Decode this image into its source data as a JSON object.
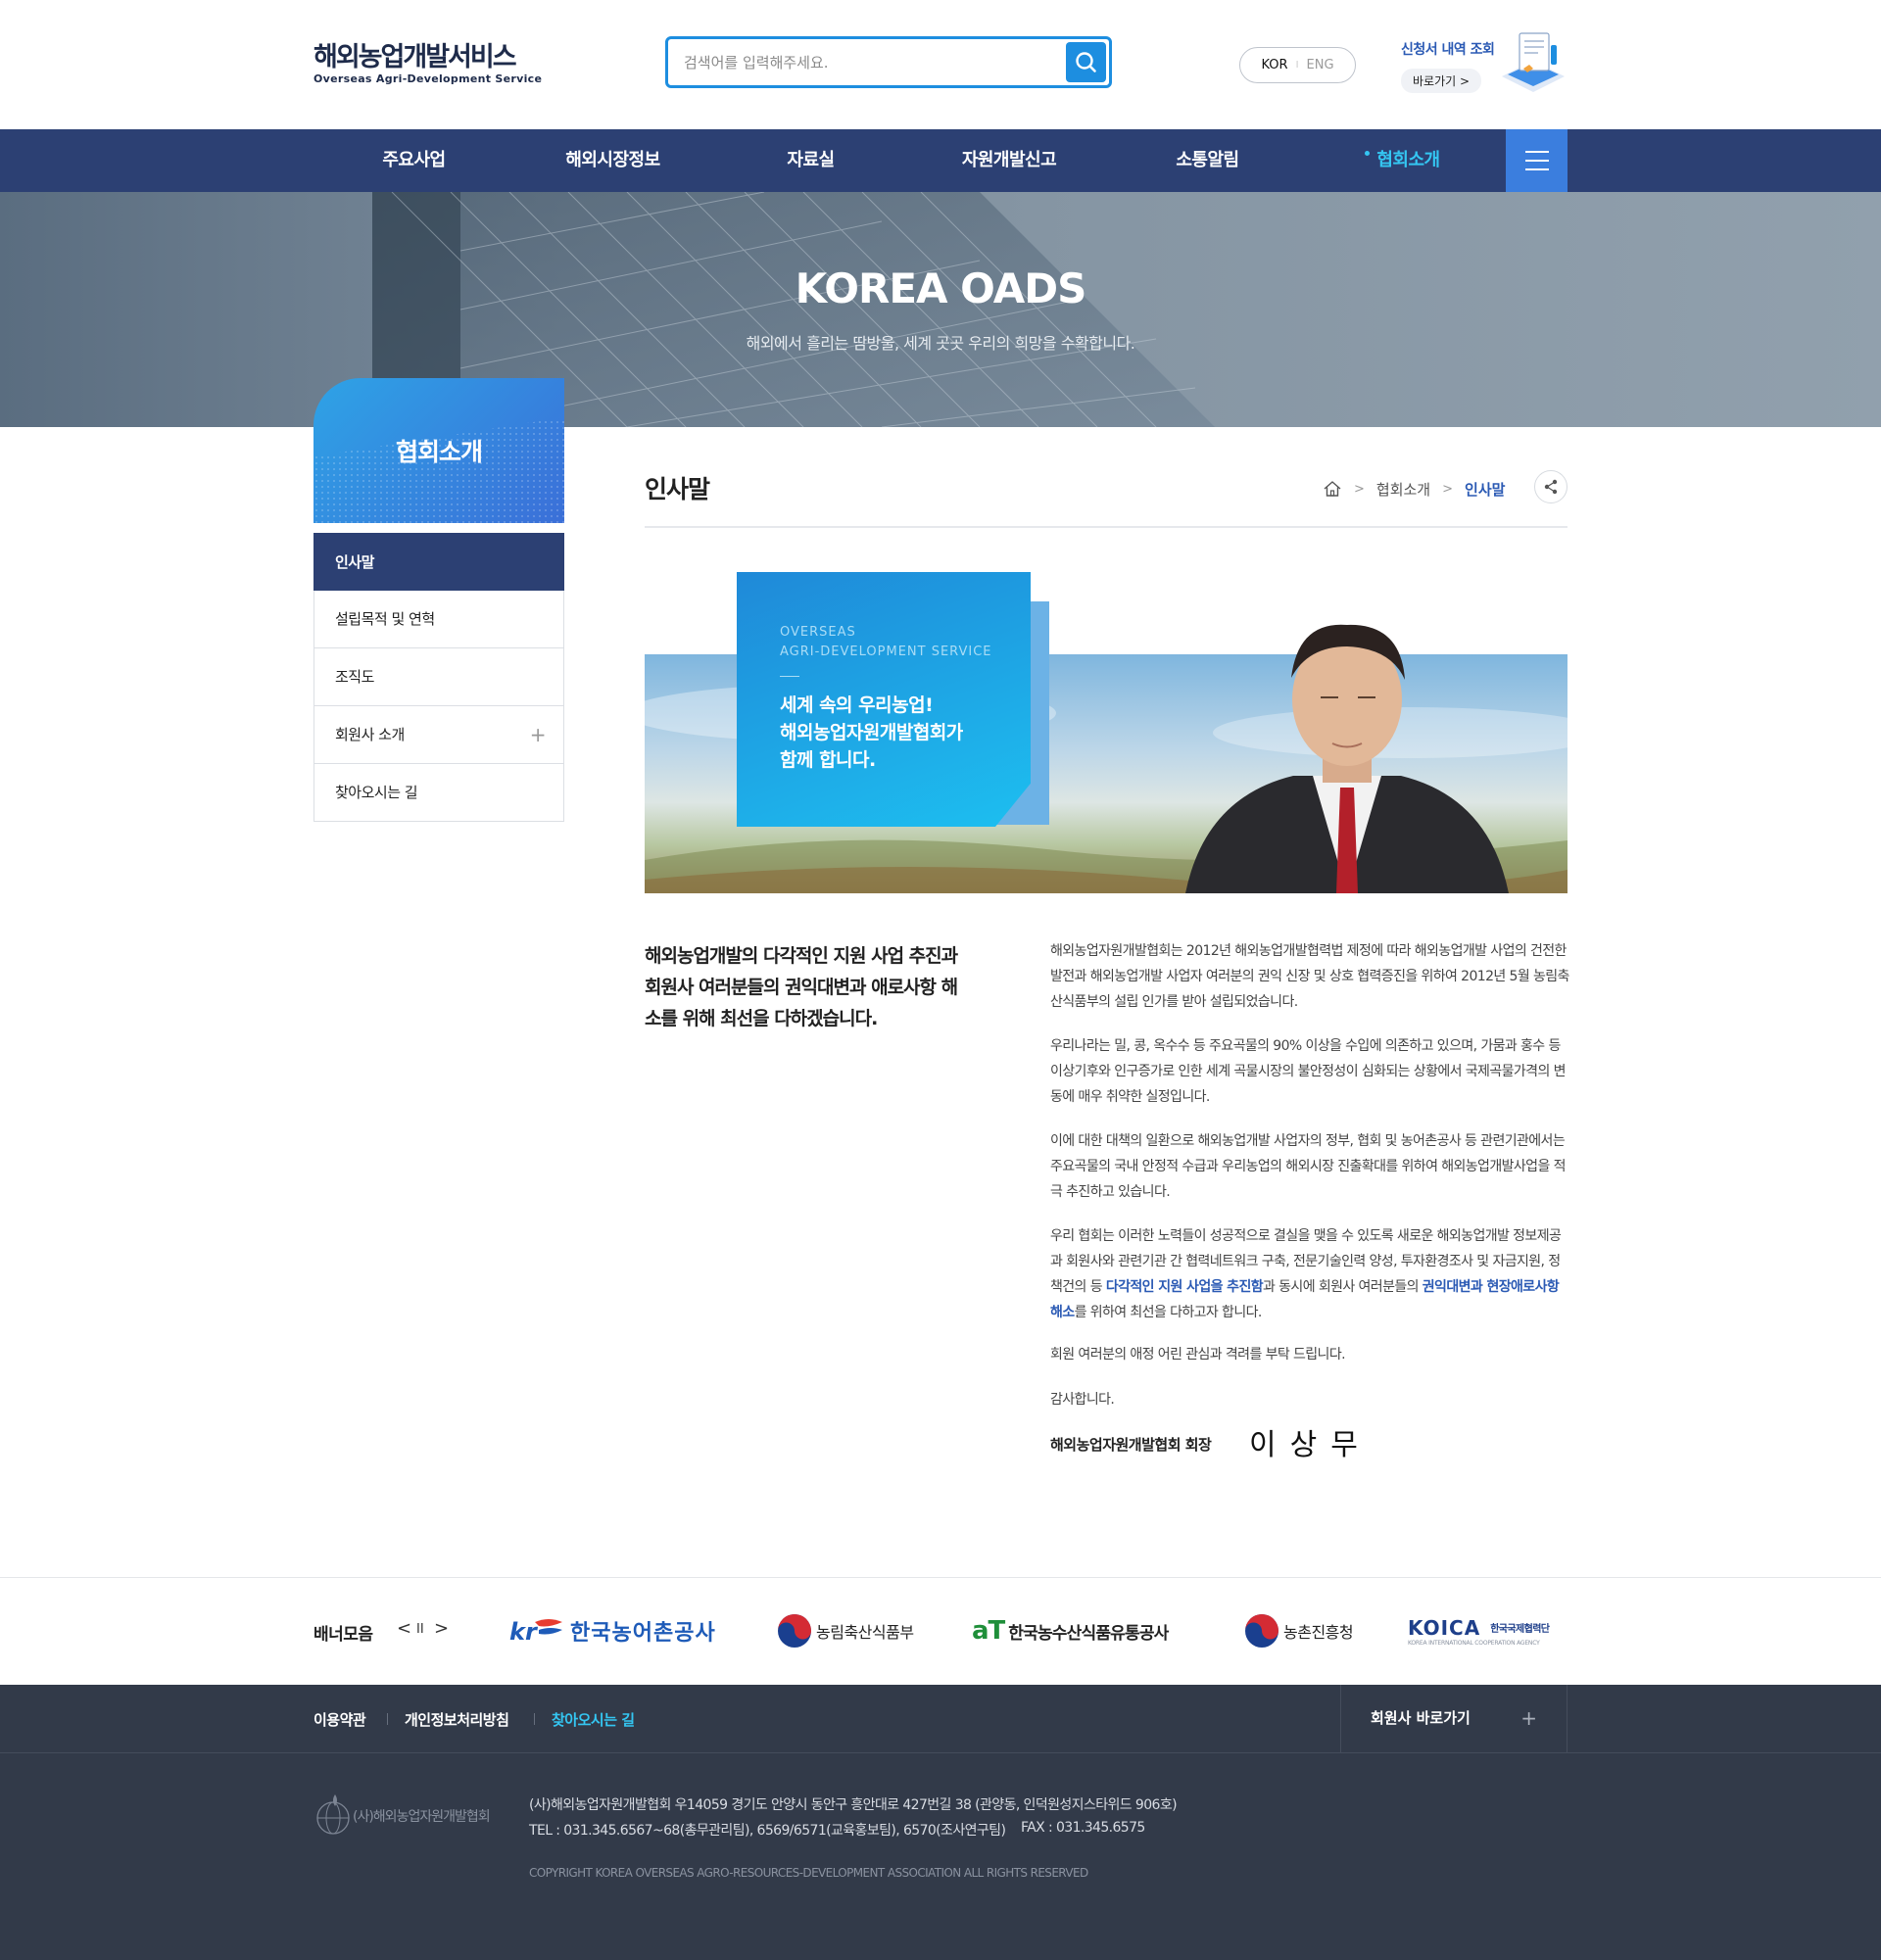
{
  "header": {
    "logo_kr": "해외농업개발서비스",
    "logo_en": "Overseas Agri-Development Service",
    "search_placeholder": "검색어를 입력해주세요.",
    "lang_kor": "KOR",
    "lang_sep": "I",
    "lang_eng": "ENG",
    "application_title": "신청서 내역 조회",
    "application_link": "바로가기 >"
  },
  "nav": {
    "items": [
      "주요사업",
      "해외시장정보",
      "자료실",
      "자원개발신고",
      "소통알림",
      "협회소개"
    ],
    "active": "협회소개"
  },
  "hero": {
    "title": "KOREA OADS",
    "subtitle": "해외에서 흘리는 땀방울, 세계 곳곳 우리의 희망을 수확합니다."
  },
  "sidebar": {
    "title": "협회소개",
    "items": [
      {
        "label": "인사말",
        "active": true
      },
      {
        "label": "설립목적 및 연혁"
      },
      {
        "label": "조직도"
      },
      {
        "label": "회원사 소개",
        "expandable": true
      },
      {
        "label": "찾아오시는 길"
      }
    ],
    "plus_symbol": "+"
  },
  "content": {
    "title": "인사말",
    "breadcrumb": [
      "협회소개",
      "인사말"
    ],
    "visual_small": "OVERSEAS\nAGRI-DEVELOPMENT SERVICE",
    "visual_line1": "세계 속의 우리농업!",
    "visual_line2": "해외농업자원개발협회가",
    "visual_line3": "함께 합니다.",
    "lead": "해외농업개발의 다각적인 지원 사업 추진과 회원사 여러분들의 권익대변과 애로사항 해소를 위해 최선을 다하겠습니다.",
    "p1": "해외농업자원개발협회는 2012년 해외농업개발협력법 제정에 따라 해외농업개발 사업의 건전한 발전과 해외농업개발 사업자 여러분의 권익 신장 및 상호 협력증진을 위하여 2012년 5월 농림축산식품부의 설립 인가를 받아 설립되었습니다.",
    "p2": "우리나라는 밀, 콩, 옥수수 등 주요곡물의 90% 이상을 수입에 의존하고 있으며, 가뭄과 홍수 등 이상기후와 인구증가로 인한 세계 곡물시장의 불안정성이 심화되는 상황에서 국제곡물가격의 변동에 매우 취약한 실정입니다.",
    "p3": "이에 대한 대책의 일환으로 해외농업개발 사업자의 정부, 협회 및 농어촌공사 등 관련기관에서는 주요곡물의 국내 안정적 수급과 우리농업의 해외시장 진출확대를 위하여 해외농업개발사업을 적극 추진하고 있습니다.",
    "p4_a": "우리 협회는 이러한 노력들이 성공적으로 결실을 맺을 수 있도록 새로운 해외농업개발 정보제공과 회원사와 관련기관 간 협력네트워크 구축, 전문기술인력 양성, 투자환경조사 및 자금지원, 정책건의 등 ",
    "p4_hl1": "다각적인 지원 사업을 추진함",
    "p4_b": "과 동시에 회원사 여러분들의 ",
    "p4_hl2": "권익대변과 현장애로사항 해소",
    "p4_c": "를 위하여 최선을 다하고자 합니다.",
    "p5": "회원 여러분의 애정 어린 관심과 격려를 부탁 드립니다.",
    "p6": "감사합니다.",
    "sign_title": "해외농업자원개발협회 회장",
    "sign_name": "이상무"
  },
  "banners": {
    "title": "배너모음",
    "prev": "<",
    "pause": "II",
    "next": ">",
    "items": [
      "한국농어촌공사",
      "농림축산식품부",
      "한국농수산식품유통공사",
      "농촌진흥청",
      "KOICA",
      "한국국제협력단",
      "KOREA INTERNATIONAL COOPERATION AGENCY"
    ]
  },
  "footer": {
    "links": [
      "이용약관",
      "개인정보처리방침",
      "찾아오시는 길"
    ],
    "member_link": "회원사 바로가기",
    "member_plus": "+",
    "logo_text": "(사)해외농업자원개발협회",
    "address": "(사)해외농업자원개발협회 우14059 경기도 안양시 동안구 흥안대로 427번길 38 (관양동, 인덕원성지스타위드 906호)",
    "tel": "TEL : 031.345.6567~68(총무관리팀), 6569/6571(교육홍보팀), 6570(조사연구팀)",
    "fax": "FAX : 031.345.6575",
    "copyright": "COPYRIGHT KOREA OVERSEAS AGRO-RESOURCES-DEVELOPMENT ASSOCIATION ALL RIGHTS RESERVED"
  },
  "colors": {
    "navy": "#2c4073",
    "accent_blue": "#1d8ee0",
    "cyan": "#34c6f2",
    "footer": "#323a49"
  }
}
